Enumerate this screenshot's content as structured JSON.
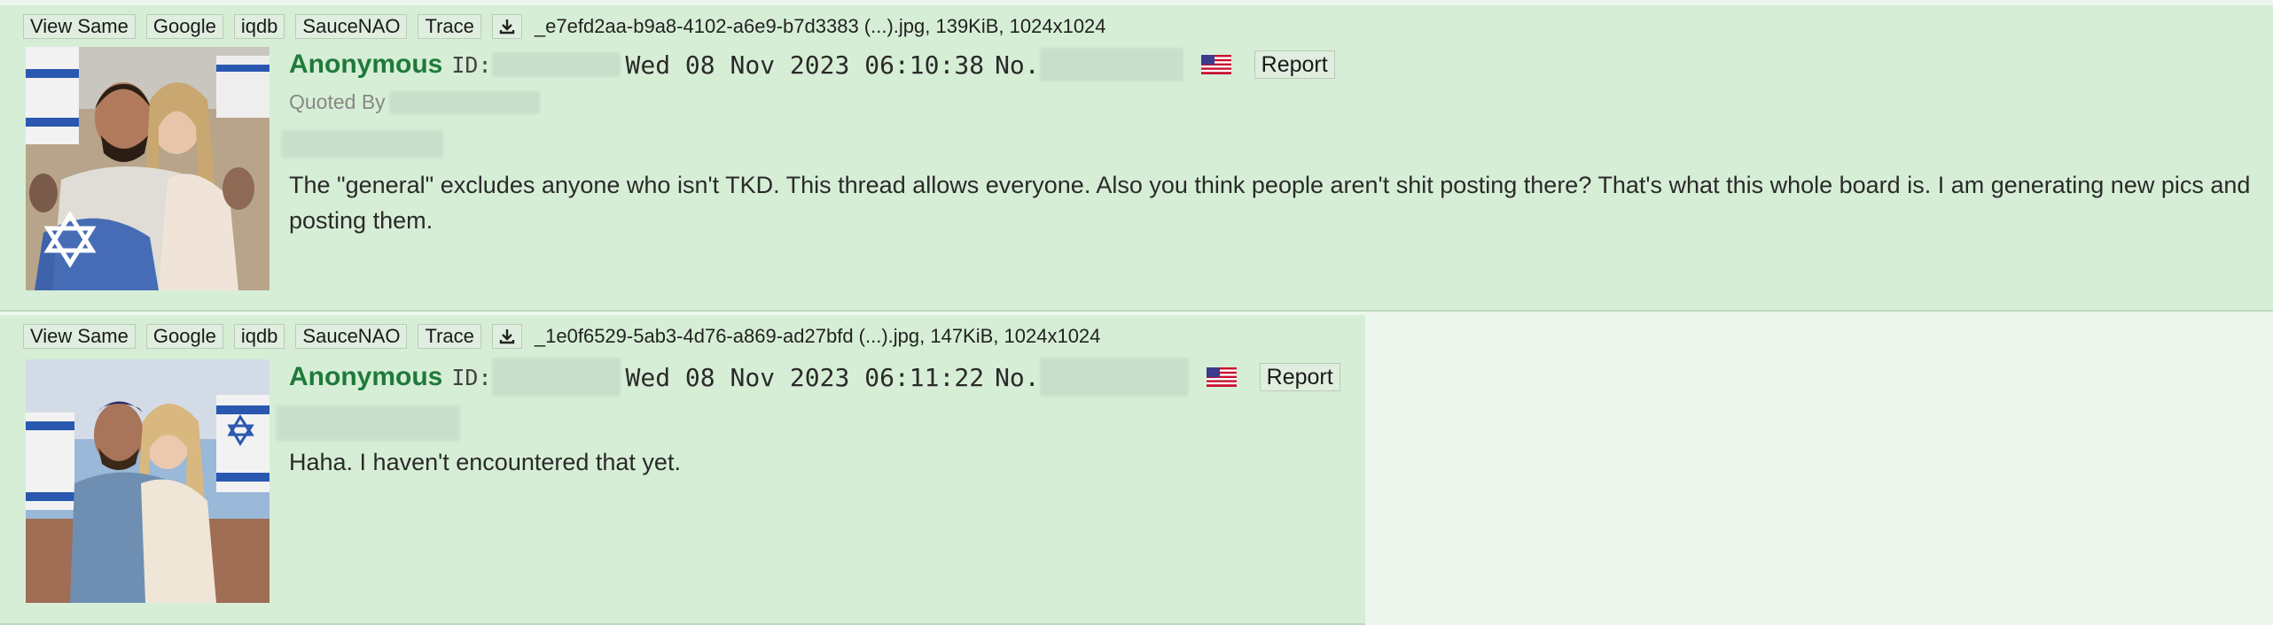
{
  "toolbar_buttons": {
    "view_same": "View Same",
    "google": "Google",
    "iqdb": "iqdb",
    "saucenao": "SauceNAO",
    "trace": "Trace",
    "download_icon": "download-icon"
  },
  "posts": [
    {
      "file_info": "_e7efd2aa-b9a8-4102-a6e9-b7d3383 (...).jpg, 139KiB, 1024x1024",
      "name": "Anonymous",
      "id_label": "ID:",
      "date": "Wed 08 Nov 2023 06:10:38",
      "no_label": "No.",
      "flag_icon": "us-flag-icon",
      "report_label": "Report",
      "quoted_by": "Quoted By",
      "comment": "The \"general\" excludes anyone who isn't TKD. This thread allows everyone. Also you think people aren't shit posting there? That's what this whole board is. I am generating new pics and posting them."
    },
    {
      "file_info": "_1e0f6529-5ab3-4d76-a869-ad27bfd (...).jpg, 147KiB, 1024x1024",
      "name": "Anonymous",
      "id_label": "ID:",
      "date": "Wed 08 Nov 2023 06:11:22",
      "no_label": "No.",
      "flag_icon": "us-flag-icon",
      "report_label": "Report",
      "comment": "Haha. I haven't encountered that yet."
    }
  ],
  "colors": {
    "post_bg": "#d6eed6",
    "page_bg": "#edf6ec",
    "name": "#1f7a3a"
  }
}
